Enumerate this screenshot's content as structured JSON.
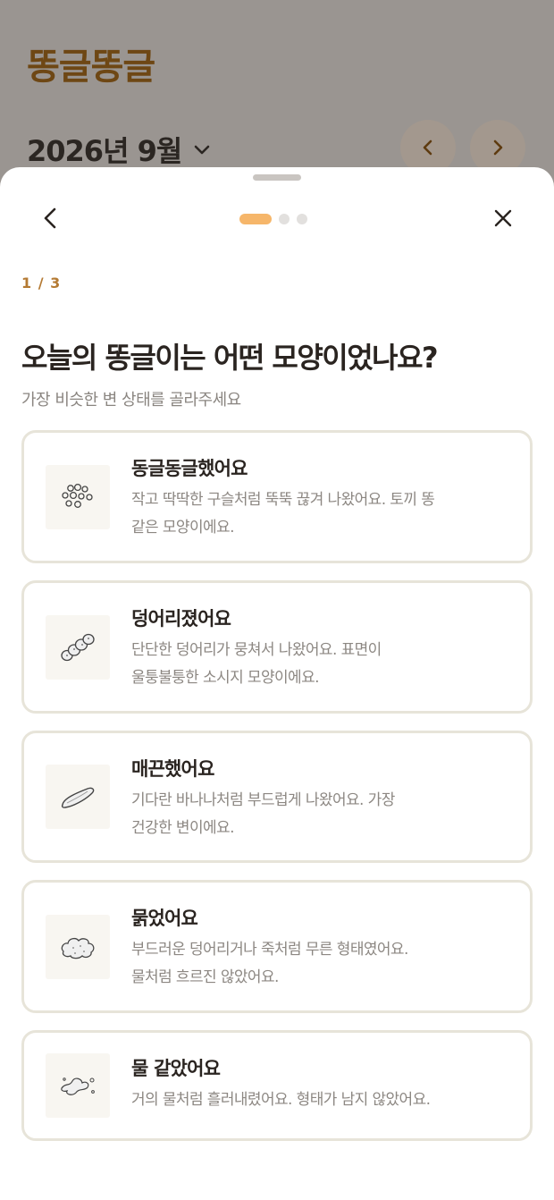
{
  "app": {
    "title": "똥글똥글",
    "month": "2026년 9월"
  },
  "sheet": {
    "step": "1 / 3",
    "question": "오늘의 똥글이는 어떤 모양이었나요?",
    "subtitle": "가장 비슷한 변 상태를 골라주세요",
    "progress": {
      "current": 1,
      "total": 3
    }
  },
  "options": [
    {
      "title": "동글동글했어요",
      "desc1": "작고 딱딱한 구슬처럼 뚝뚝 끊겨 나왔어요. 토끼 똥",
      "desc2": "같은 모양이에요.",
      "icon": "pellets-icon"
    },
    {
      "title": "덩어리졌어요",
      "desc1": "단단한 덩어리가 뭉쳐서 나왔어요. 표면이",
      "desc2": "울퉁불퉁한 소시지 모양이에요.",
      "icon": "lumpy-sausage-icon"
    },
    {
      "title": "매끈했어요",
      "desc1": "기다란 바나나처럼 부드럽게 나왔어요. 가장",
      "desc2": "건강한 변이에요.",
      "icon": "smooth-banana-icon"
    },
    {
      "title": "묽었어요",
      "desc1": "부드러운 덩어리거나 죽처럼 무른 형태였어요.",
      "desc2": "물처럼 흐르진 않았어요.",
      "icon": "mushy-blob-icon"
    },
    {
      "title": "물 같았어요",
      "desc1": "거의 물처럼 흘러내렸어요. 형태가 남지 않았어요.",
      "desc2": "",
      "icon": "watery-splash-icon"
    }
  ],
  "colors": {
    "brand": "#6e4714",
    "accent": "#f6b66a",
    "step": "#b47a33",
    "card_border": "#e7e4d9"
  }
}
